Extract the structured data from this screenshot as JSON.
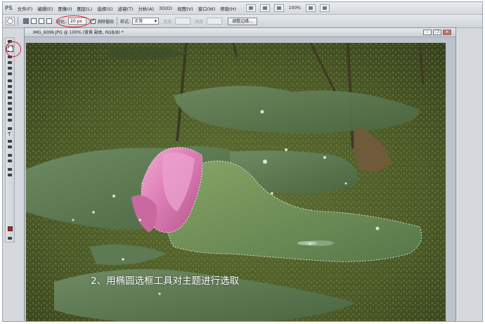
{
  "app": {
    "logo": "PS"
  },
  "menubar": {
    "items": [
      "文件(F)",
      "编辑(E)",
      "图像(I)",
      "图层(L)",
      "选择(S)",
      "滤镜(T)",
      "分析(A)",
      "3D(D)",
      "视图(V)",
      "窗口(W)",
      "帮助(H)"
    ],
    "zoom": "100%"
  },
  "options": {
    "feather_label": "羽化:",
    "feather_value": "20 px",
    "antialias_label": "消除锯齿",
    "style_label": "样式:",
    "style_value": "正常",
    "width_label": "宽度:",
    "height_label": "高度:",
    "refine_edge_button": "调整边缘..."
  },
  "document": {
    "title": "IMG_6099.JPG @ 100% (背景 副本, RGB/8) *",
    "caption": "2、用椭圆选框工具对主题进行选取"
  },
  "colors": {
    "annotation": "#e01a2a",
    "foreground": "#ec0b16",
    "background": "#ffffff"
  }
}
